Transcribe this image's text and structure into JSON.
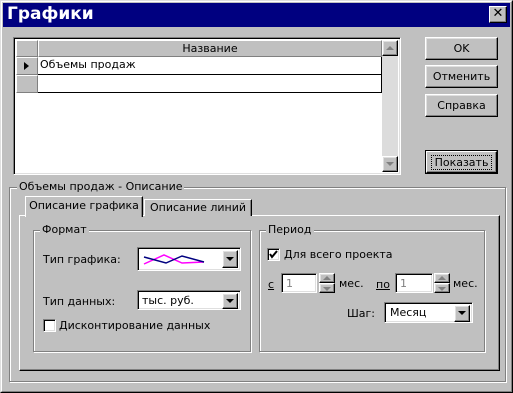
{
  "window": {
    "title": "Графики",
    "close_glyph": "✕"
  },
  "grid": {
    "column_header": "Название",
    "rows": [
      {
        "name": "Объемы продаж"
      },
      {
        "name": ""
      }
    ]
  },
  "buttons": {
    "ok": "OK",
    "cancel": "Отменить",
    "help": "Справка",
    "show": "Показать"
  },
  "description_group": {
    "label": "Объемы продаж - Описание",
    "tabs": [
      "Описание графика",
      "Описание линий"
    ],
    "active_tab": 0
  },
  "format": {
    "label": "Формат",
    "chart_type_label": "Тип графика:",
    "data_type_label": "Тип данных:",
    "data_type_value": "тыс. руб.",
    "discount_label": "Дисконтирование данных",
    "discount_checked": false,
    "chart_type_preview_colors": {
      "line_a": "#ff00ff",
      "line_b": "#000080"
    }
  },
  "period": {
    "label": "Период",
    "whole_project_label": "Для всего проекта",
    "whole_project_checked": true,
    "from_label": "с",
    "from_value": "1",
    "from_unit": "мес.",
    "to_label": "по",
    "to_value": "1",
    "to_unit": "мес.",
    "step_label": "Шаг:",
    "step_value": "Месяц"
  },
  "colors": {
    "titlebar": "#000080",
    "face": "#c0c0c0"
  }
}
